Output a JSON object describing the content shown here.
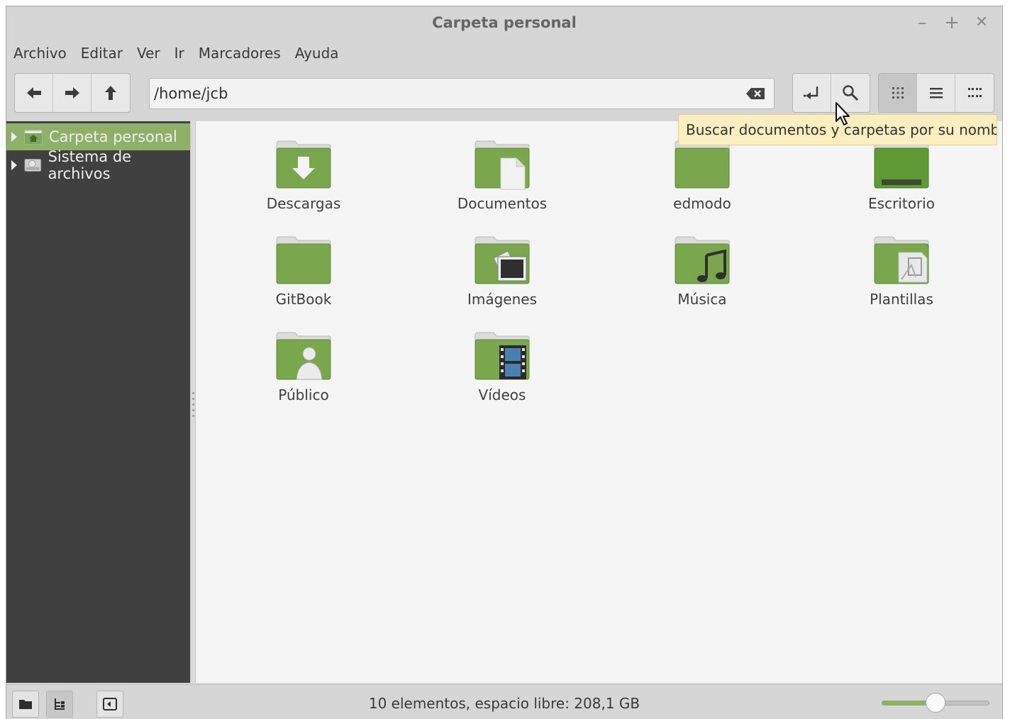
{
  "window": {
    "title": "Carpeta personal",
    "controls": [
      "–",
      "+",
      "✕"
    ]
  },
  "menubar": [
    "Archivo",
    "Editar",
    "Ver",
    "Ir",
    "Marcadores",
    "Ayuda"
  ],
  "toolbar": {
    "location": "/home/jcb"
  },
  "tooltip": "Buscar documentos y carpetas por su nombre",
  "sidebar": {
    "items": [
      {
        "label": "Carpeta personal",
        "icon": "home-folder-icon",
        "selected": true
      },
      {
        "label": "Sistema de archivos",
        "icon": "drive-icon",
        "selected": false
      }
    ]
  },
  "files": [
    {
      "name": "Descargas",
      "icon": "download-folder-icon"
    },
    {
      "name": "Documentos",
      "icon": "documents-folder-icon"
    },
    {
      "name": "edmodo",
      "icon": "folder-icon"
    },
    {
      "name": "Escritorio",
      "icon": "desktop-folder-icon"
    },
    {
      "name": "GitBook",
      "icon": "folder-icon"
    },
    {
      "name": "Imágenes",
      "icon": "pictures-folder-icon"
    },
    {
      "name": "Música",
      "icon": "music-folder-icon"
    },
    {
      "name": "Plantillas",
      "icon": "templates-folder-icon"
    },
    {
      "name": "Público",
      "icon": "public-folder-icon"
    },
    {
      "name": "Vídeos",
      "icon": "videos-folder-icon"
    }
  ],
  "status": {
    "text": "10 elementos, espacio libre: 208,1 GB",
    "zoom_level": 0.5
  },
  "colors": {
    "accent": "#8fb069",
    "folder": "#7aa64e",
    "sidebar": "#404040"
  }
}
